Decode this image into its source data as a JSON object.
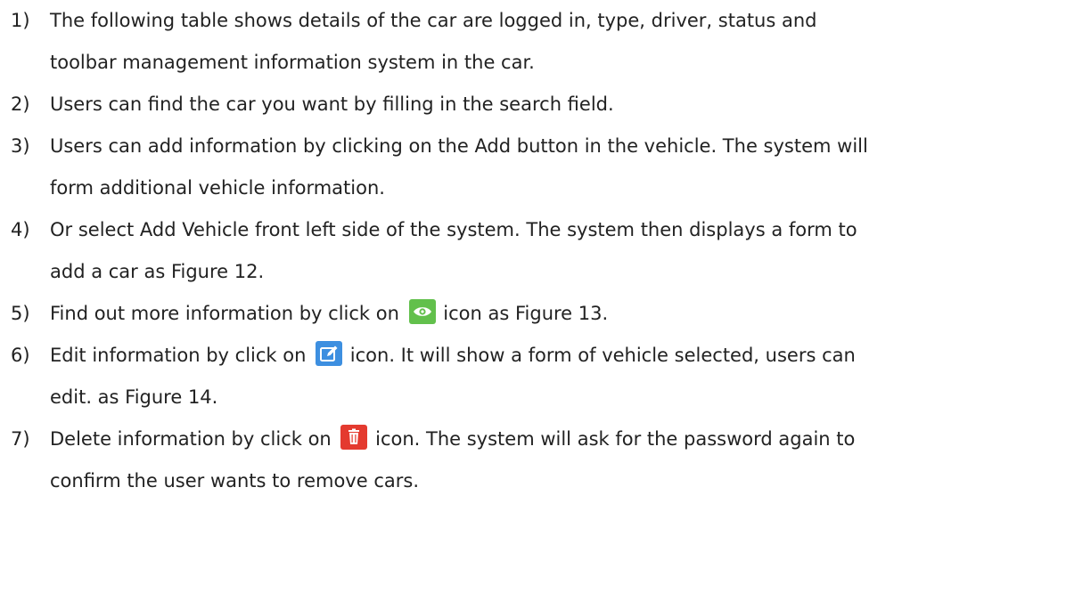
{
  "items": [
    {
      "num": "1)",
      "lines": [
        "The following table shows details of the car are logged in, type, driver, status and",
        "toolbar management information system in the car."
      ]
    },
    {
      "num": "2)",
      "lines": [
        "Users can find the car you want by filling in the search field."
      ]
    },
    {
      "num": "3)",
      "lines": [
        "Users can add information by clicking on the Add button in the vehicle. The system will",
        "form additional vehicle information."
      ]
    },
    {
      "num": "4)",
      "lines": [
        "Or select Add Vehicle front left side of the system. The system then displays a form to",
        "add a car as Figure 12."
      ]
    },
    {
      "num": "5)",
      "before_icon": "Find out more information by click on",
      "after_icon": "icon as Figure 13."
    },
    {
      "num": "6)",
      "before_icon": "Edit information by click on",
      "after_icon": "icon. It will show a form of vehicle selected, users can",
      "lines_after": [
        "edit. as Figure 14."
      ]
    },
    {
      "num": "7)",
      "before_icon": "Delete information by click on",
      "after_icon": "icon. The system will ask for the password again to",
      "lines_after": [
        "confirm the user wants to remove cars."
      ]
    }
  ],
  "icons": {
    "view": {
      "name": "eye-icon",
      "color": "#62c04c"
    },
    "edit": {
      "name": "edit-icon",
      "color": "#3d8fe0"
    },
    "delete": {
      "name": "trash-icon",
      "color": "#e43a2f"
    }
  }
}
